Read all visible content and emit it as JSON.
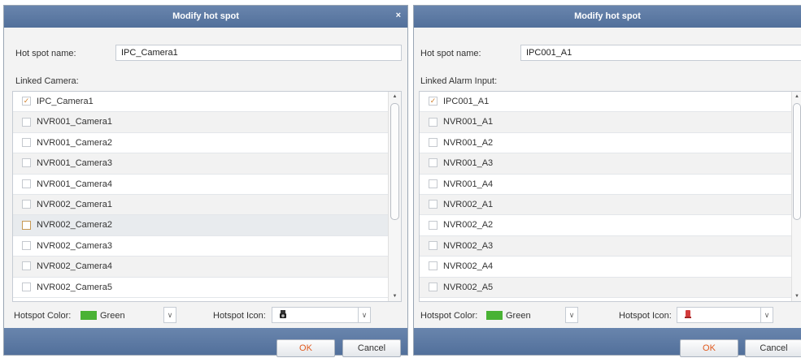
{
  "dialogs": [
    {
      "title": "Modify hot spot",
      "close_glyph": "×",
      "name_label": "Hot spot name:",
      "name_value": "IPC_Camera1",
      "linked_label": "Linked Camera:",
      "items": [
        {
          "label": "IPC_Camera1",
          "checked": true
        },
        {
          "label": "NVR001_Camera1",
          "checked": false
        },
        {
          "label": "NVR001_Camera2",
          "checked": false
        },
        {
          "label": "NVR001_Camera3",
          "checked": false
        },
        {
          "label": "NVR001_Camera4",
          "checked": false
        },
        {
          "label": "NVR002_Camera1",
          "checked": false
        },
        {
          "label": "NVR002_Camera2",
          "checked": false,
          "highlighted": true
        },
        {
          "label": "NVR002_Camera3",
          "checked": false
        },
        {
          "label": "NVR002_Camera4",
          "checked": false
        },
        {
          "label": "NVR002_Camera5",
          "checked": false
        }
      ],
      "color_label": "Hotspot Color:",
      "color_value": "Green",
      "color_hex": "#49b234",
      "icon_label": "Hotspot Icon:",
      "icon_name": "camera-icon",
      "ok_label": "OK",
      "cancel_label": "Cancel"
    },
    {
      "title": "Modify hot spot",
      "name_label": "Hot spot name:",
      "name_value": "IPC001_A1",
      "linked_label": "Linked Alarm Input:",
      "items": [
        {
          "label": "IPC001_A1",
          "checked": true
        },
        {
          "label": "NVR001_A1",
          "checked": false
        },
        {
          "label": "NVR001_A2",
          "checked": false
        },
        {
          "label": "NVR001_A3",
          "checked": false
        },
        {
          "label": "NVR001_A4",
          "checked": false
        },
        {
          "label": "NVR002_A1",
          "checked": false
        },
        {
          "label": "NVR002_A2",
          "checked": false
        },
        {
          "label": "NVR002_A3",
          "checked": false
        },
        {
          "label": "NVR002_A4",
          "checked": false
        },
        {
          "label": "NVR002_A5",
          "checked": false
        }
      ],
      "color_label": "Hotspot Color:",
      "color_value": "Green",
      "color_hex": "#49b234",
      "icon_label": "Hotspot Icon:",
      "icon_name": "alarm-input-icon",
      "ok_label": "OK",
      "cancel_label": "Cancel"
    }
  ],
  "theme": {
    "titlebar_color": "#5f7ba5",
    "ok_text_color": "#e05a1e",
    "check_color": "#d07f2a"
  }
}
